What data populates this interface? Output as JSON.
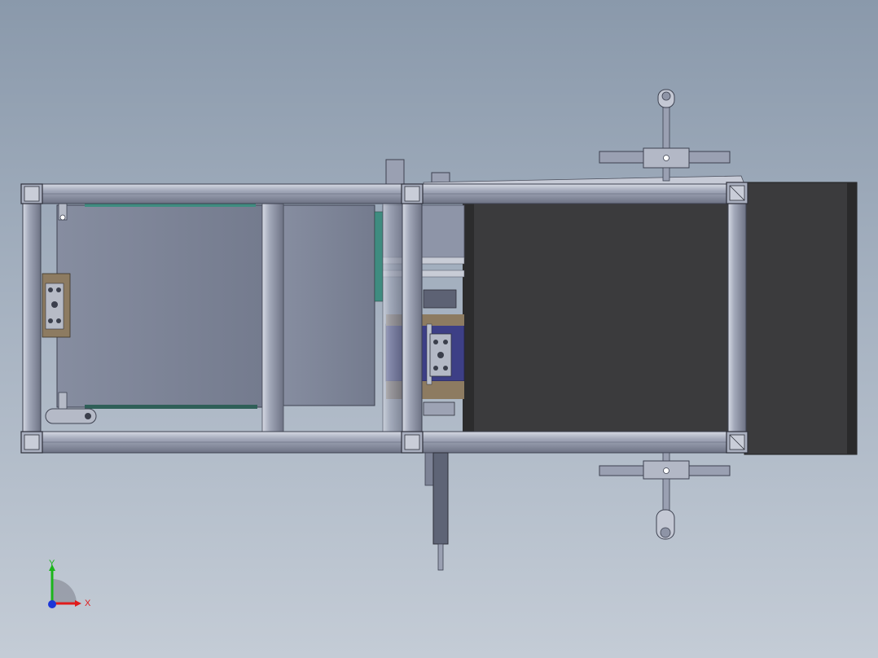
{
  "colors": {
    "frame": "#9ea4b6",
    "frame_dark": "#4a4e5c",
    "panel": "#7c8396",
    "dark_panel": "#3b3b3d",
    "teal": "#3f8c80",
    "navy": "#3d3f86",
    "tan": "#8d7b61",
    "x_axis": "#e01b1b",
    "y_axis": "#1bb51b",
    "z_axis": "#1b36d8"
  },
  "triad": {
    "x_label": "X",
    "y_label": "Y"
  }
}
